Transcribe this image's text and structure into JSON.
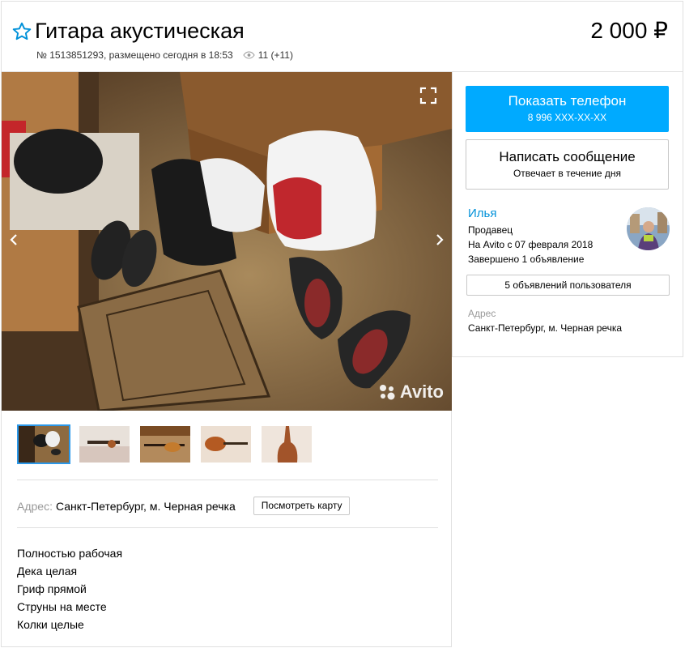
{
  "listing": {
    "title": "Гитара акустическая",
    "price": "2 000 ₽",
    "number_posted": "№ 1513851293, размещено сегодня в 18:53",
    "views": "11 (+11)"
  },
  "gallery": {
    "watermark": "Avito",
    "thumbnail_count": 5,
    "active_thumbnail": 0
  },
  "address": {
    "label": "Адрес:",
    "value": "Санкт-Петербург, м. Черная речка",
    "map_button": "Посмотреть карту"
  },
  "description": [
    "Полностью рабочая",
    "Дека целая",
    "Гриф прямой",
    "Струны на месте",
    "Колки целые"
  ],
  "contact": {
    "phone_button": "Показать телефон",
    "phone_masked": "8 996 XXX-XX-XX",
    "message_button": "Написать сообщение",
    "message_subtext": "Отвечает в течение дня"
  },
  "seller": {
    "name": "Илья",
    "role": "Продавец",
    "since": "На Avito с 07 февраля 2018",
    "completed": "Завершено 1 объявление",
    "ads_button": "5 объявлений пользователя",
    "address_label": "Адрес",
    "address_value": "Санкт-Петербург, м. Черная речка"
  },
  "colors": {
    "accent_blue": "#00aaff",
    "link_blue": "#0091d9",
    "thumb_active_border": "#2b98e9"
  },
  "icons": {
    "favorite": "star-outline-icon",
    "views": "eye-icon",
    "fullscreen": "fullscreen-icon",
    "prev": "chevron-left-icon",
    "next": "chevron-right-icon"
  }
}
